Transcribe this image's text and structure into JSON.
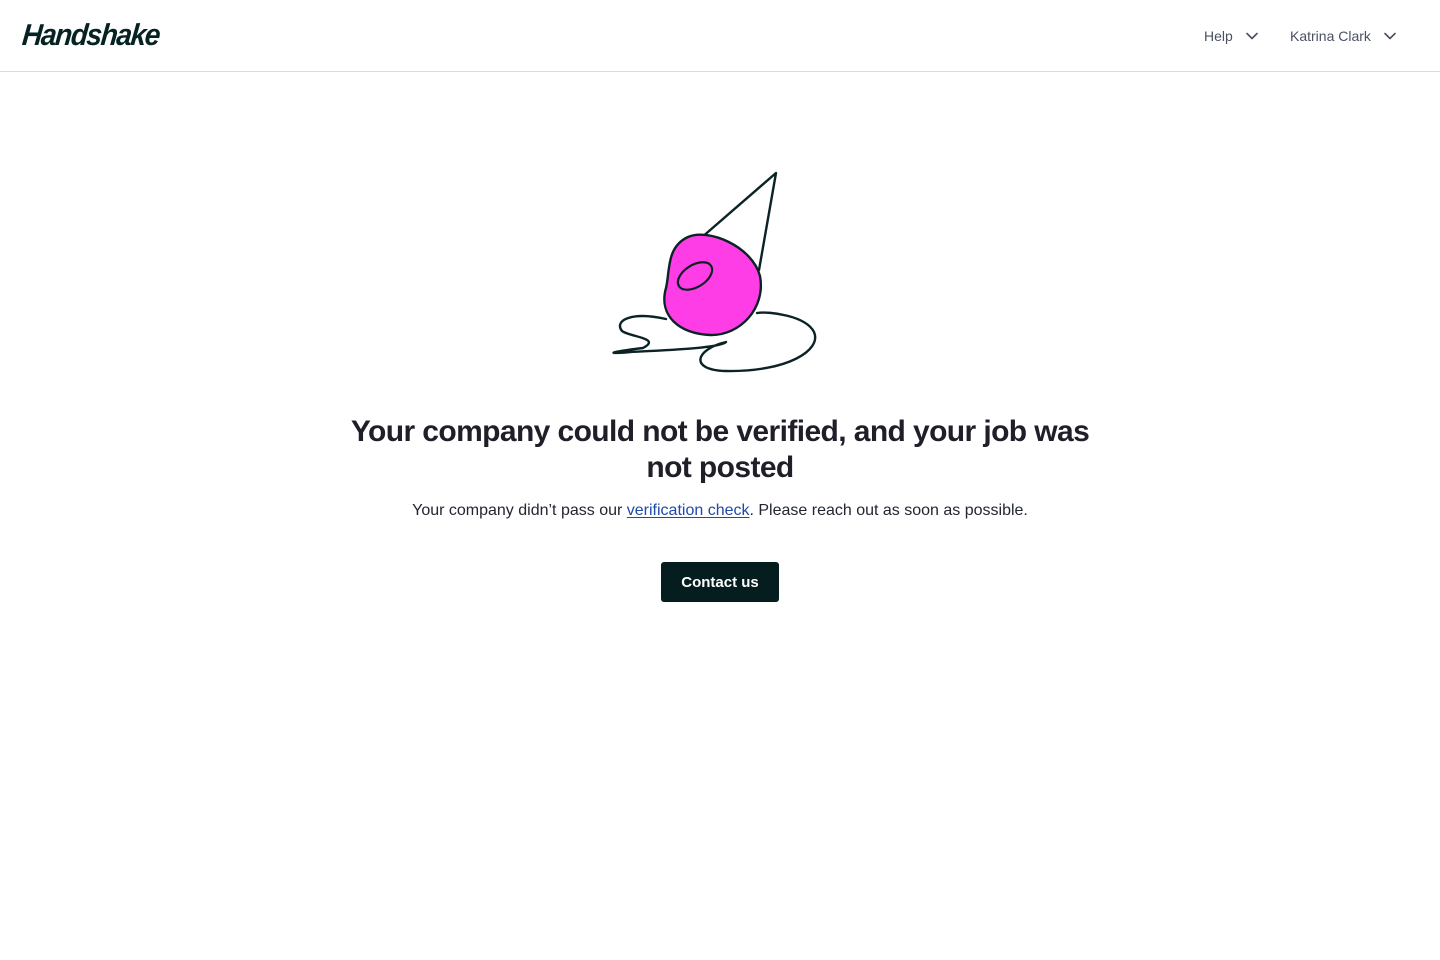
{
  "header": {
    "logo_text": "Handshake",
    "help_label": "Help",
    "user_name": "Katrina Clark",
    "icons": {
      "help_chevron": "chevron-down-icon",
      "user_chevron": "chevron-down-icon"
    }
  },
  "illustration": {
    "name": "party-hat-illustration",
    "accent_color": "#ff3de6",
    "stroke_color": "#0b2325"
  },
  "main": {
    "headline": "Your company could not be verified, and your job was not posted",
    "body_before_link": "Your company didn’t pass our ",
    "link_text": "verification check",
    "body_after_link": ". Please reach out as soon as possible.",
    "cta_label": "Contact us"
  },
  "colors": {
    "brand_dark": "#061d1f",
    "link": "#1f4aa8",
    "accent_pink": "#ff3de6"
  }
}
